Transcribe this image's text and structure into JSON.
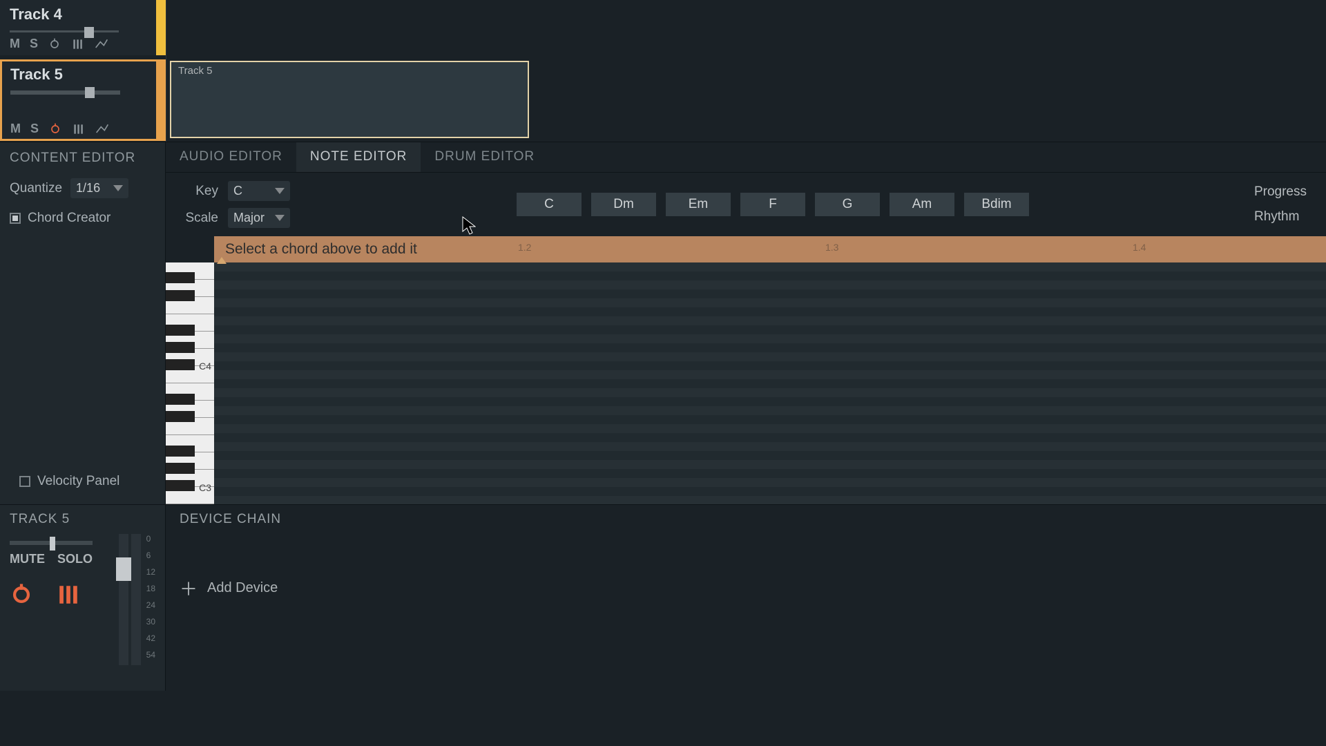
{
  "tracks": {
    "t4": {
      "name": "Track 4",
      "mute": "M",
      "solo": "S"
    },
    "t5": {
      "name": "Track 5",
      "mute": "M",
      "solo": "S",
      "clip_label": "Track 5"
    }
  },
  "content_editor": {
    "title": "CONTENT EDITOR",
    "quantize_label": "Quantize",
    "quantize_value": "1/16",
    "chord_creator_label": "Chord Creator",
    "velocity_panel_label": "Velocity Panel"
  },
  "tabs": {
    "audio": "AUDIO EDITOR",
    "note": "NOTE EDITOR",
    "drum": "DRUM EDITOR"
  },
  "keyscale": {
    "key_label": "Key",
    "key_value": "C",
    "scale_label": "Scale",
    "scale_value": "Major"
  },
  "chords": [
    "C",
    "Dm",
    "Em",
    "F",
    "G",
    "Am",
    "Bdim"
  ],
  "right_labels": {
    "progress": "Progress",
    "rhythm": "Rhythm"
  },
  "chord_banner": {
    "hint": "Select a chord above to add it",
    "ticks": [
      "1.2",
      "1.3",
      "1.4"
    ]
  },
  "piano": {
    "c4": "C4",
    "c3": "C3"
  },
  "track_panel": {
    "title": "TRACK 5",
    "mute": "MUTE",
    "solo": "SOLO",
    "meter_scale": [
      "0",
      "6",
      "12",
      "18",
      "24",
      "30",
      "42",
      "54"
    ]
  },
  "device_chain": {
    "title": "DEVICE CHAIN",
    "add_device": "Add Device"
  }
}
